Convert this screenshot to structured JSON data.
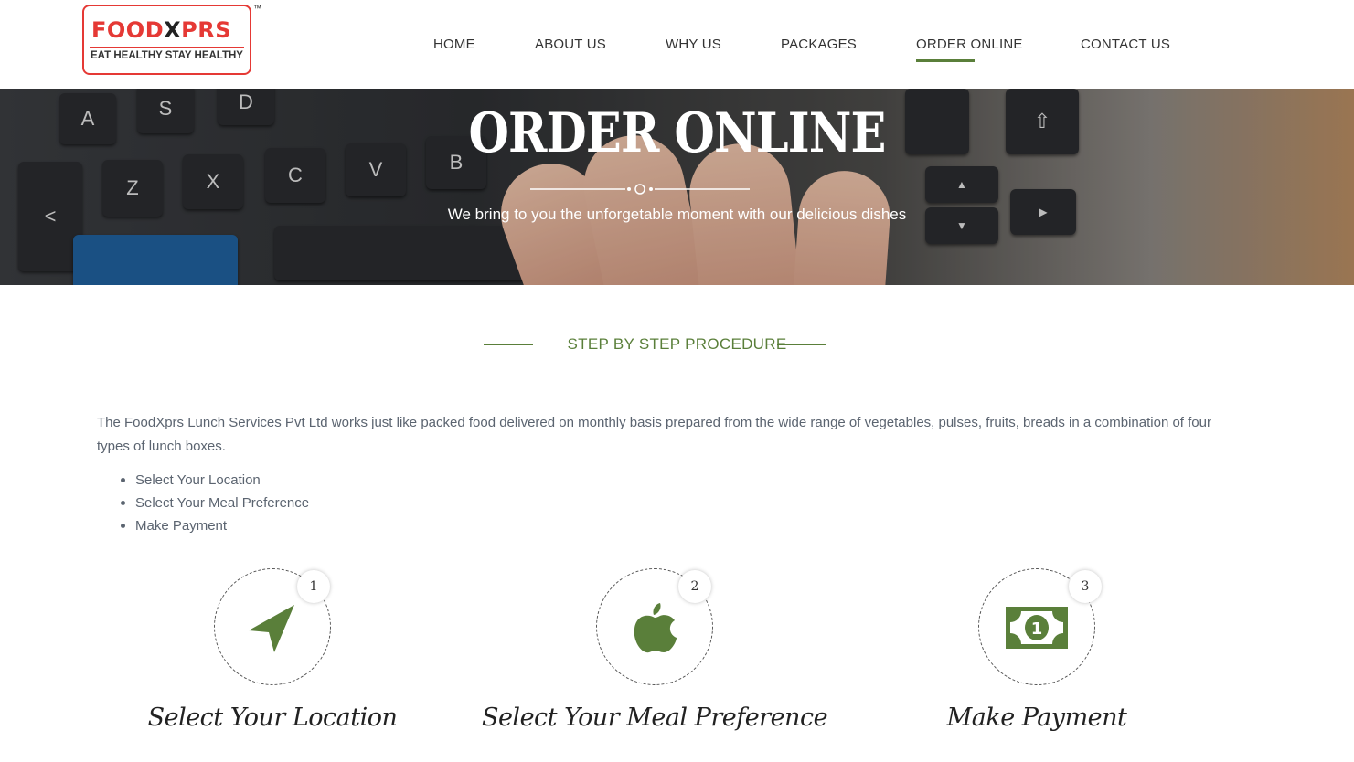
{
  "brand": {
    "name_left": "FOOD",
    "name_x": "X",
    "name_right": "PRS",
    "tagline": "EAT HEALTHY STAY HEALTHY",
    "trademark": "™"
  },
  "nav": {
    "items": [
      {
        "label": "HOME"
      },
      {
        "label": "ABOUT US"
      },
      {
        "label": "WHY US"
      },
      {
        "label": "PACKAGES"
      },
      {
        "label": "ORDER ONLINE",
        "active": true
      },
      {
        "label": "CONTACT US"
      }
    ]
  },
  "hero": {
    "title": "ORDER ONLINE",
    "subtitle": "We bring to you the unforgetable moment with our delicious dishes"
  },
  "procedure": {
    "heading": "STEP BY STEP PROCEDURE",
    "description": "The FoodXprs Lunch Services Pvt Ltd works just like packed food delivered on monthly basis prepared from the wide range of vegetables, pulses, fruits, breads in a combination of four types of lunch boxes.",
    "bullets": [
      "Select Your Location",
      "Select Your Meal Preference",
      "Make Payment"
    ],
    "steps": [
      {
        "number": "1",
        "title": "Select Your Location",
        "icon": "location-arrow-icon"
      },
      {
        "number": "2",
        "title": "Select Your Meal Preference",
        "icon": "apple-icon"
      },
      {
        "number": "3",
        "title": "Make Payment",
        "icon": "money-bill-icon"
      }
    ]
  },
  "colors": {
    "accent": "#5a7f3a",
    "brand_red": "#e53935"
  }
}
